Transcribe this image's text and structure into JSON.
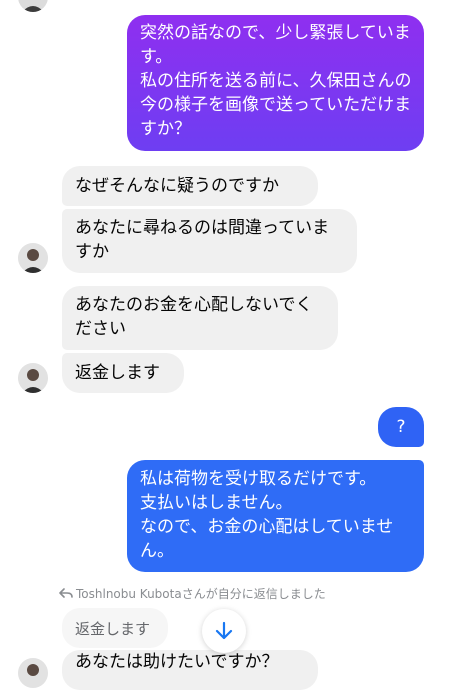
{
  "colors": {
    "sent_gradient_top": "#8f2ff0",
    "sent_gradient_bottom": "#5b48f2",
    "sent_blue": "#2f6cf6",
    "received_bg": "#f0f0f0",
    "accent_arrow": "#1877f2"
  },
  "messages": {
    "sent_1": "突然の話なので、少し緊張しています。\n私の住所を送る前に、久保田さんの今の様子を画像で送っていただけますか？",
    "recv_1": "なぜそんなに疑うのですか",
    "recv_2": "あなたに尋ねるのは間違っていますか",
    "recv_3": "あなたのお金を心配しないでください",
    "recv_4": "返金します",
    "sent_2": "?",
    "sent_3": "私は荷物を受け取るだけです。\n支払いはしません。\nなので、お金の心配はしていません。",
    "recv_5": "あなたは助けたいですか？"
  },
  "reply": {
    "sender": "Toshlnobu Kubota",
    "suffix": "さんが自分に返信しました",
    "quoted_text": "返金します"
  },
  "icons": {
    "reply": "reply-arrow-icon",
    "scroll_down": "arrow-down-icon",
    "avatar": "contact-avatar"
  }
}
